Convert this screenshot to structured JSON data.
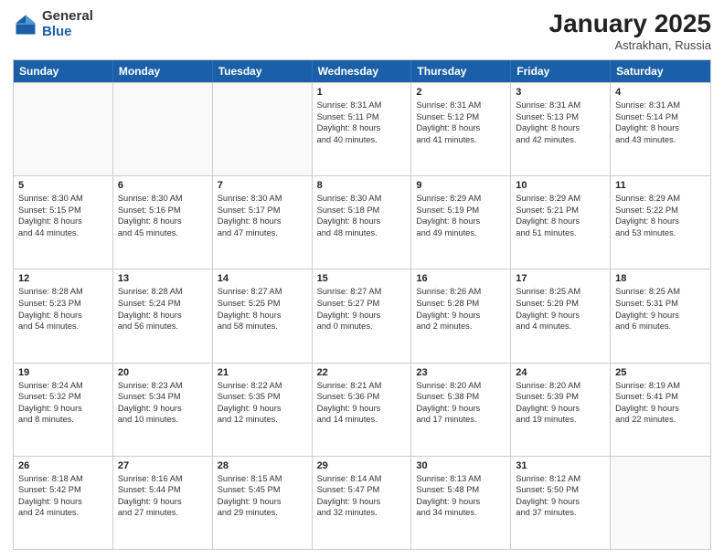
{
  "logo": {
    "general": "General",
    "blue": "Blue"
  },
  "title": "January 2025",
  "subtitle": "Astrakhan, Russia",
  "days": [
    "Sunday",
    "Monday",
    "Tuesday",
    "Wednesday",
    "Thursday",
    "Friday",
    "Saturday"
  ],
  "weeks": [
    [
      {
        "day": "",
        "lines": []
      },
      {
        "day": "",
        "lines": []
      },
      {
        "day": "",
        "lines": []
      },
      {
        "day": "1",
        "lines": [
          "Sunrise: 8:31 AM",
          "Sunset: 5:11 PM",
          "Daylight: 8 hours",
          "and 40 minutes."
        ]
      },
      {
        "day": "2",
        "lines": [
          "Sunrise: 8:31 AM",
          "Sunset: 5:12 PM",
          "Daylight: 8 hours",
          "and 41 minutes."
        ]
      },
      {
        "day": "3",
        "lines": [
          "Sunrise: 8:31 AM",
          "Sunset: 5:13 PM",
          "Daylight: 8 hours",
          "and 42 minutes."
        ]
      },
      {
        "day": "4",
        "lines": [
          "Sunrise: 8:31 AM",
          "Sunset: 5:14 PM",
          "Daylight: 8 hours",
          "and 43 minutes."
        ]
      }
    ],
    [
      {
        "day": "5",
        "lines": [
          "Sunrise: 8:30 AM",
          "Sunset: 5:15 PM",
          "Daylight: 8 hours",
          "and 44 minutes."
        ]
      },
      {
        "day": "6",
        "lines": [
          "Sunrise: 8:30 AM",
          "Sunset: 5:16 PM",
          "Daylight: 8 hours",
          "and 45 minutes."
        ]
      },
      {
        "day": "7",
        "lines": [
          "Sunrise: 8:30 AM",
          "Sunset: 5:17 PM",
          "Daylight: 8 hours",
          "and 47 minutes."
        ]
      },
      {
        "day": "8",
        "lines": [
          "Sunrise: 8:30 AM",
          "Sunset: 5:18 PM",
          "Daylight: 8 hours",
          "and 48 minutes."
        ]
      },
      {
        "day": "9",
        "lines": [
          "Sunrise: 8:29 AM",
          "Sunset: 5:19 PM",
          "Daylight: 8 hours",
          "and 49 minutes."
        ]
      },
      {
        "day": "10",
        "lines": [
          "Sunrise: 8:29 AM",
          "Sunset: 5:21 PM",
          "Daylight: 8 hours",
          "and 51 minutes."
        ]
      },
      {
        "day": "11",
        "lines": [
          "Sunrise: 8:29 AM",
          "Sunset: 5:22 PM",
          "Daylight: 8 hours",
          "and 53 minutes."
        ]
      }
    ],
    [
      {
        "day": "12",
        "lines": [
          "Sunrise: 8:28 AM",
          "Sunset: 5:23 PM",
          "Daylight: 8 hours",
          "and 54 minutes."
        ]
      },
      {
        "day": "13",
        "lines": [
          "Sunrise: 8:28 AM",
          "Sunset: 5:24 PM",
          "Daylight: 8 hours",
          "and 56 minutes."
        ]
      },
      {
        "day": "14",
        "lines": [
          "Sunrise: 8:27 AM",
          "Sunset: 5:25 PM",
          "Daylight: 8 hours",
          "and 58 minutes."
        ]
      },
      {
        "day": "15",
        "lines": [
          "Sunrise: 8:27 AM",
          "Sunset: 5:27 PM",
          "Daylight: 9 hours",
          "and 0 minutes."
        ]
      },
      {
        "day": "16",
        "lines": [
          "Sunrise: 8:26 AM",
          "Sunset: 5:28 PM",
          "Daylight: 9 hours",
          "and 2 minutes."
        ]
      },
      {
        "day": "17",
        "lines": [
          "Sunrise: 8:25 AM",
          "Sunset: 5:29 PM",
          "Daylight: 9 hours",
          "and 4 minutes."
        ]
      },
      {
        "day": "18",
        "lines": [
          "Sunrise: 8:25 AM",
          "Sunset: 5:31 PM",
          "Daylight: 9 hours",
          "and 6 minutes."
        ]
      }
    ],
    [
      {
        "day": "19",
        "lines": [
          "Sunrise: 8:24 AM",
          "Sunset: 5:32 PM",
          "Daylight: 9 hours",
          "and 8 minutes."
        ]
      },
      {
        "day": "20",
        "lines": [
          "Sunrise: 8:23 AM",
          "Sunset: 5:34 PM",
          "Daylight: 9 hours",
          "and 10 minutes."
        ]
      },
      {
        "day": "21",
        "lines": [
          "Sunrise: 8:22 AM",
          "Sunset: 5:35 PM",
          "Daylight: 9 hours",
          "and 12 minutes."
        ]
      },
      {
        "day": "22",
        "lines": [
          "Sunrise: 8:21 AM",
          "Sunset: 5:36 PM",
          "Daylight: 9 hours",
          "and 14 minutes."
        ]
      },
      {
        "day": "23",
        "lines": [
          "Sunrise: 8:20 AM",
          "Sunset: 5:38 PM",
          "Daylight: 9 hours",
          "and 17 minutes."
        ]
      },
      {
        "day": "24",
        "lines": [
          "Sunrise: 8:20 AM",
          "Sunset: 5:39 PM",
          "Daylight: 9 hours",
          "and 19 minutes."
        ]
      },
      {
        "day": "25",
        "lines": [
          "Sunrise: 8:19 AM",
          "Sunset: 5:41 PM",
          "Daylight: 9 hours",
          "and 22 minutes."
        ]
      }
    ],
    [
      {
        "day": "26",
        "lines": [
          "Sunrise: 8:18 AM",
          "Sunset: 5:42 PM",
          "Daylight: 9 hours",
          "and 24 minutes."
        ]
      },
      {
        "day": "27",
        "lines": [
          "Sunrise: 8:16 AM",
          "Sunset: 5:44 PM",
          "Daylight: 9 hours",
          "and 27 minutes."
        ]
      },
      {
        "day": "28",
        "lines": [
          "Sunrise: 8:15 AM",
          "Sunset: 5:45 PM",
          "Daylight: 9 hours",
          "and 29 minutes."
        ]
      },
      {
        "day": "29",
        "lines": [
          "Sunrise: 8:14 AM",
          "Sunset: 5:47 PM",
          "Daylight: 9 hours",
          "and 32 minutes."
        ]
      },
      {
        "day": "30",
        "lines": [
          "Sunrise: 8:13 AM",
          "Sunset: 5:48 PM",
          "Daylight: 9 hours",
          "and 34 minutes."
        ]
      },
      {
        "day": "31",
        "lines": [
          "Sunrise: 8:12 AM",
          "Sunset: 5:50 PM",
          "Daylight: 9 hours",
          "and 37 minutes."
        ]
      },
      {
        "day": "",
        "lines": []
      }
    ]
  ]
}
